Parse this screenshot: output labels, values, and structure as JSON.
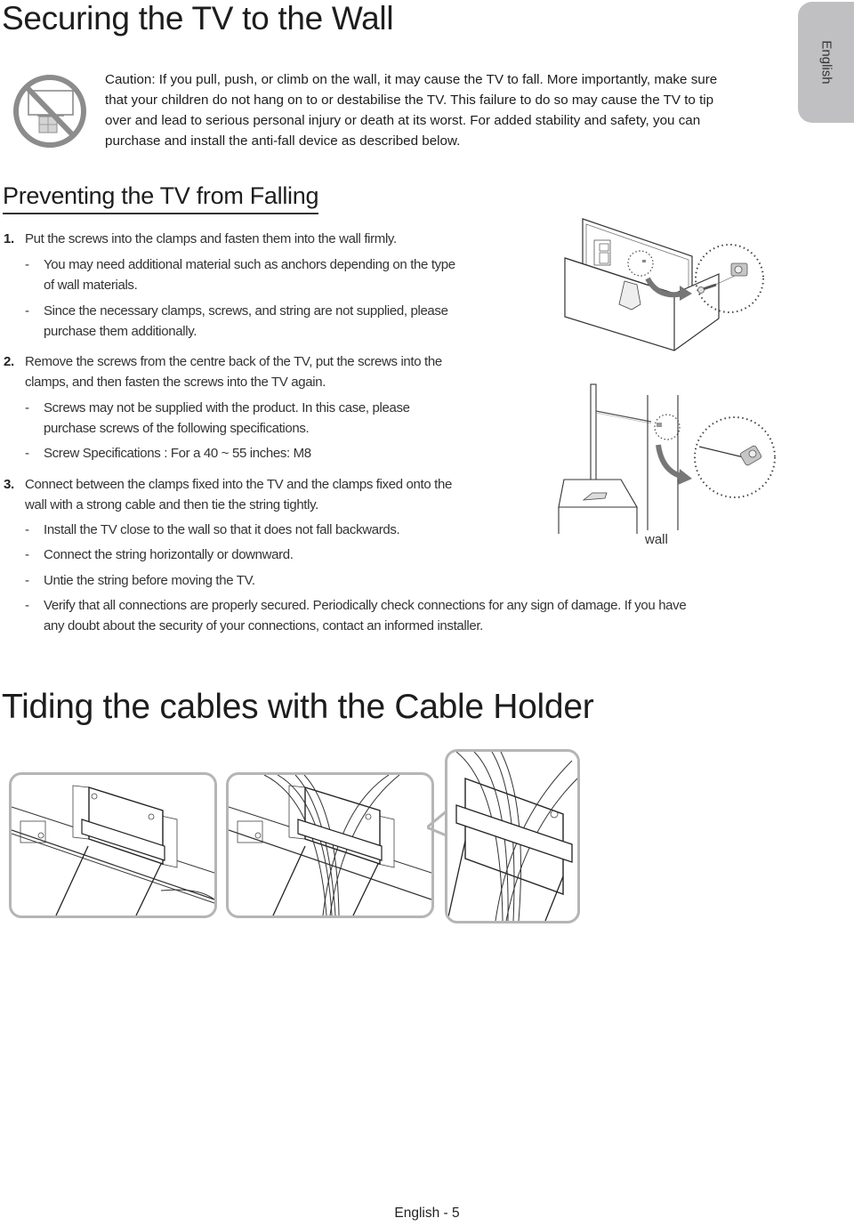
{
  "page": {
    "title": "Securing the TV to the Wall",
    "language_tab": "English",
    "footer": "English - 5"
  },
  "caution": {
    "icon": "no-tv-on-furniture-prohibition-icon",
    "lines": [
      "Caution: If you pull, push, or climb on the wall, it may cause the TV to fall. More importantly, make sure",
      "that your children do not hang on to or destabilise the TV. This failure to do so may cause the TV to tip",
      "over and lead to serious personal injury or death at its worst. For added stability and safety, you can",
      "purchase and install the anti-fall device as described below."
    ]
  },
  "preventing": {
    "heading": "Preventing the TV from Falling",
    "steps": [
      {
        "number": "1.",
        "lines": [
          "Put the screws into the clamps and fasten them into the wall firmly."
        ],
        "bullets": [
          {
            "dash": "-",
            "lines": [
              "You may need additional material such as anchors depending on the type",
              "of wall materials."
            ]
          },
          {
            "dash": "-",
            "lines": [
              "Since the necessary clamps, screws, and string are not supplied, please",
              "purchase them additionally."
            ]
          }
        ]
      },
      {
        "number": "2.",
        "lines": [
          "Remove the screws from the centre back of the TV, put the screws into the",
          "clamps, and then fasten the screws into the TV again."
        ],
        "bullets": [
          {
            "dash": "-",
            "lines": [
              "Screws may not be supplied with the product. In this case, please",
              "purchase screws of the following specifications."
            ]
          },
          {
            "dash": "-",
            "lines": [
              "Screw Specifications : For a 40 ~ 55 inches: M8"
            ]
          }
        ]
      },
      {
        "number": "3.",
        "lines": [
          "Connect between the clamps fixed into the TV and the clamps fixed onto the",
          "wall with a strong cable and then tie the string tightly."
        ],
        "bullets": [
          {
            "dash": "-",
            "lines": [
              "Install the TV close to the wall so that it does not fall backwards."
            ]
          },
          {
            "dash": "-",
            "lines": [
              "Connect the string horizontally or downward."
            ]
          },
          {
            "dash": "-",
            "lines": [
              "Untie the string before moving the TV."
            ]
          },
          {
            "dash": "-",
            "lines": [
              "Verify that all connections are properly secured. Periodically check connections for any sign of damage. If you have",
              "any doubt about the security of your connections, contact an informed installer."
            ]
          }
        ]
      }
    ],
    "illustrations": {
      "tv_back_clamp": "tv-back-screw-clamp-illustration",
      "tv_wall_string": "tv-wall-string-illustration",
      "wall_label": "wall"
    }
  },
  "cable_holder": {
    "heading": "Tiding the cables with the Cable Holder",
    "panels": [
      "cable-holder-empty-illustration",
      "cable-holder-with-cables-illustration",
      "cable-holder-detail-illustration"
    ]
  },
  "colors": {
    "text": "#1d1d1d",
    "body_text": "#333333",
    "tab_bg": "#c0c0c2",
    "panel_border": "#b5b5b5",
    "prohibition_gray": "#8c8c8c"
  }
}
